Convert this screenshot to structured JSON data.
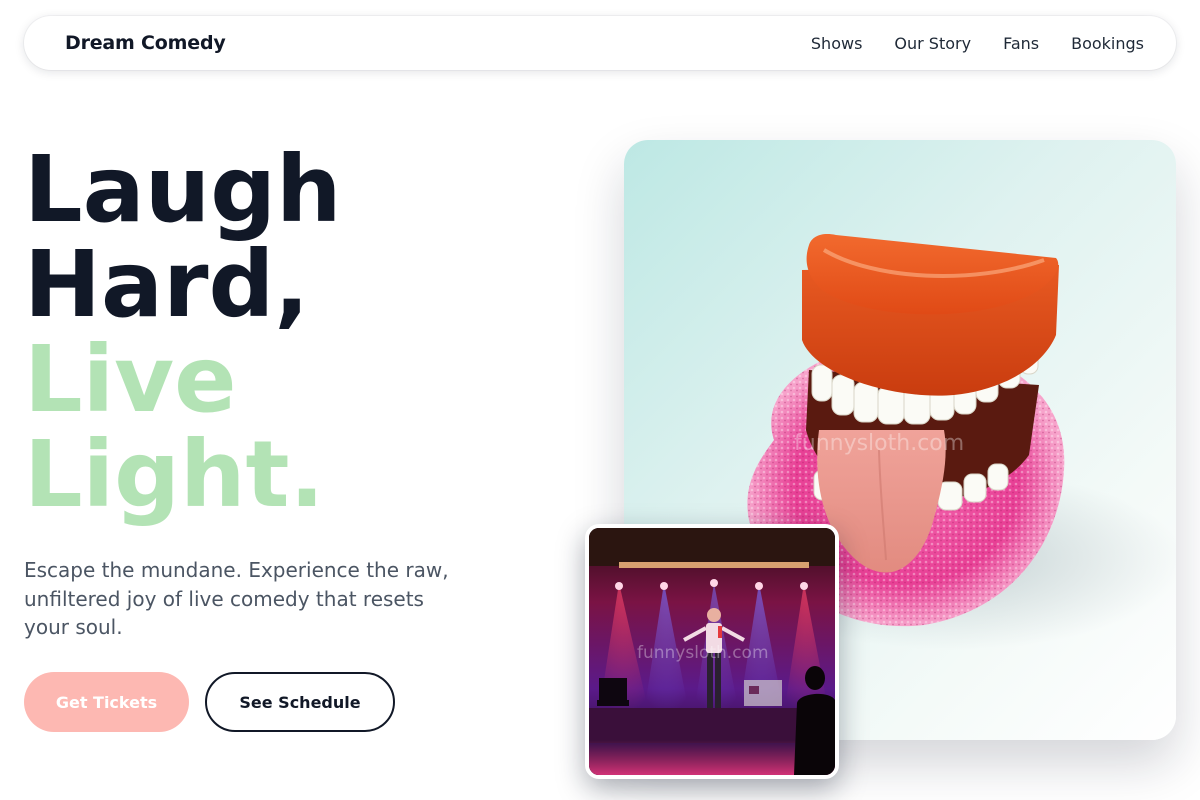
{
  "nav": {
    "brand": "Dream Comedy",
    "links": [
      "Shows",
      "Our Story",
      "Fans",
      "Bookings"
    ]
  },
  "hero": {
    "line1": "Laugh",
    "line2": "Hard,",
    "line3": "Live",
    "line4": "Light.",
    "subtitle": "Escape the mundane. Experience the raw, unfiltered joy of live comedy that resets your soul.",
    "primary_button": "Get Tickets",
    "secondary_button": "See Schedule"
  },
  "images": {
    "main_watermark": "funnysloth.com",
    "stage_watermark": "funnysloth.com"
  },
  "colors": {
    "headline_dark": "#111827",
    "headline_accent": "#b3e3b5",
    "primary_button": "#fdb8b2",
    "body_text": "#4b5563"
  }
}
